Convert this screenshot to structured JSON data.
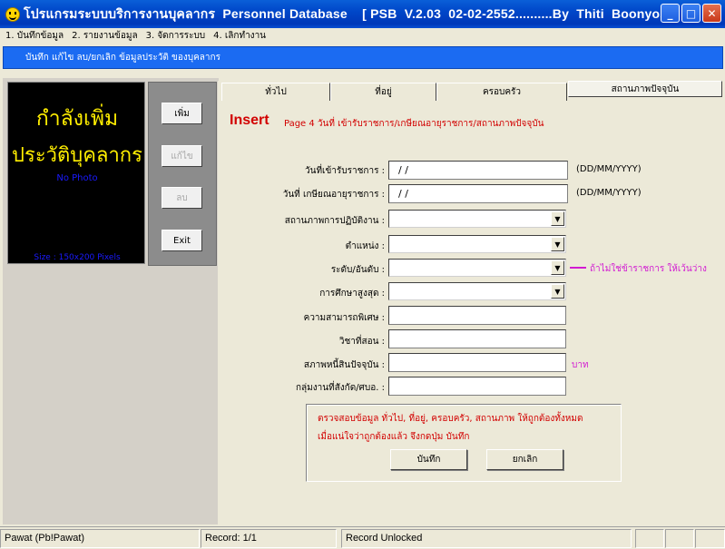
{
  "window": {
    "title": "โปรแกรมระบบบริการงานบุคลากร  Personnel Database    [ PSB  V.2.03  02-02-2552..........By  Thiti  Boonyos ]",
    "controls": {
      "minimize": "_",
      "maximize": "□",
      "close": "✕"
    }
  },
  "menu": [
    {
      "label": "1. บันทึกข้อมูล"
    },
    {
      "label": "2. รายงานข้อมูล"
    },
    {
      "label": "3. จัดการระบบ"
    },
    {
      "label": "4. เลิกทำงาน"
    }
  ],
  "banner": "บันทึก  แก้ไข  ลบ/ยกเลิก  ข้อมูลประวัติ ของบุคลากร",
  "photo_panel": {
    "line1": "กำลังเพิ่ม",
    "line2": "ประวัติบุคลากร",
    "no_photo": "No Photo",
    "size_hint": "Size : 150x200 Pixels"
  },
  "side_buttons": {
    "add": "เพิ่ม",
    "edit": "แก้ไข",
    "delete": "ลบ",
    "exit": "Exit"
  },
  "tabs": [
    {
      "label": "ทั่วไป"
    },
    {
      "label": "ที่อยู่"
    },
    {
      "label": "ครอบครัว"
    },
    {
      "label": "สถานภาพปัจจุบัน"
    }
  ],
  "form": {
    "mode": "Insert",
    "subtitle": "Page 4  วันที่ เข้ารับราชการ/เกษียณอายุราชการ/สถานภาพปัจจุบัน",
    "fields": {
      "start_date": {
        "label": "วันที่เข้ารับราชการ :",
        "value": "/ /",
        "hint": "(DD/MM/YYYY)"
      },
      "retire_date": {
        "label": "วันที่ เกษียณอายุราชการ :",
        "value": "/ /",
        "hint": "(DD/MM/YYYY)"
      },
      "work_status": {
        "label": "สถานภาพการปฏิบัติงาน :",
        "value": ""
      },
      "position": {
        "label": "ตำแหน่ง :",
        "value": ""
      },
      "level": {
        "label": "ระดับ/อันดับ :",
        "value": "",
        "hint": "ถ้าไม่ใช่ข้าราชการ ให้เว้นว่าง"
      },
      "education": {
        "label": "การศึกษาสูงสุด :",
        "value": ""
      },
      "skill": {
        "label": "ความสามารถพิเศษ :",
        "value": ""
      },
      "subject": {
        "label": "วิชาที่สอน :",
        "value": ""
      },
      "debt": {
        "label": "สภาพหนี้สินปัจจุบัน :",
        "value": "",
        "unit": "บาท"
      },
      "group": {
        "label": "กลุ่มงานที่สังกัด/ศบอ. :",
        "value": ""
      }
    },
    "note_line1": "ตรวจสอบข้อมูล ทั่วไป, ที่อยู่, ครอบครัว, สถานภาพ ให้ถูกต้องทั้งหมด",
    "note_line2": "เมื่อแน่ใจว่าถูกต้องแล้ว จึงกดปุ่ม บันทึก",
    "save_label": "บันทึก",
    "cancel_label": "ยกเลิก"
  },
  "status": {
    "user": "Pawat (Pb!Pawat)",
    "record": "Record: 1/1",
    "lock": "Record Unlocked"
  },
  "colors": {
    "title_bar": "#0047c9",
    "banner": "#1b6bf2",
    "insert_red": "#d20000",
    "photo_text": "#ffee00",
    "hint_pink": "#d21ad2",
    "photo_bg": "#000000"
  }
}
